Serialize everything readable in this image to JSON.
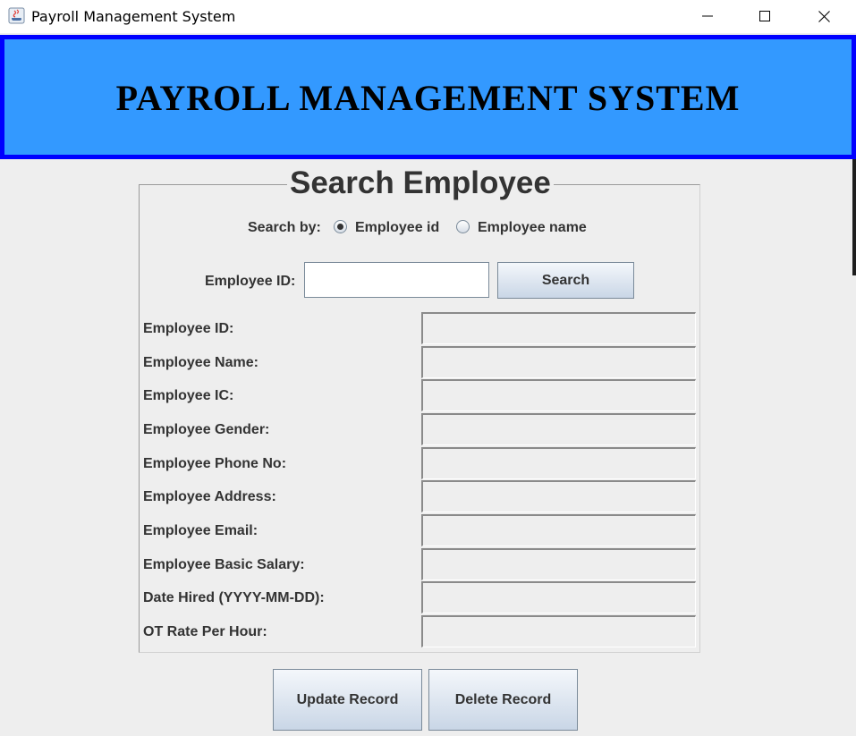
{
  "window": {
    "title": "Payroll Management System",
    "app_icon": "java-icon",
    "controls": [
      "minimize-icon",
      "maximize-icon",
      "close-icon"
    ]
  },
  "header": {
    "title": "PAYROLL MANAGEMENT SYSTEM",
    "background_color": "#3399ff",
    "border_color": "#0000ff"
  },
  "search_panel": {
    "title": "Search Employee",
    "search_by_label": "Search by:",
    "options": [
      {
        "label": "Employee id",
        "selected": true
      },
      {
        "label": "Employee name",
        "selected": false
      }
    ],
    "input_label": "Employee ID:",
    "input_value": "",
    "search_button": "Search"
  },
  "details": {
    "fields": [
      {
        "label": "Employee ID:",
        "value": ""
      },
      {
        "label": "Employee Name:",
        "value": ""
      },
      {
        "label": "Employee IC:",
        "value": ""
      },
      {
        "label": "Employee Gender:",
        "value": ""
      },
      {
        "label": "Employee Phone No:",
        "value": ""
      },
      {
        "label": "Employee Address:",
        "value": ""
      },
      {
        "label": "Employee Email:",
        "value": ""
      },
      {
        "label": "Employee Basic Salary:",
        "value": ""
      },
      {
        "label": "Date Hired (YYYY-MM-DD):",
        "value": ""
      },
      {
        "label": "OT Rate Per Hour:",
        "value": ""
      }
    ]
  },
  "actions": {
    "update": "Update Record",
    "delete": "Delete Record"
  }
}
